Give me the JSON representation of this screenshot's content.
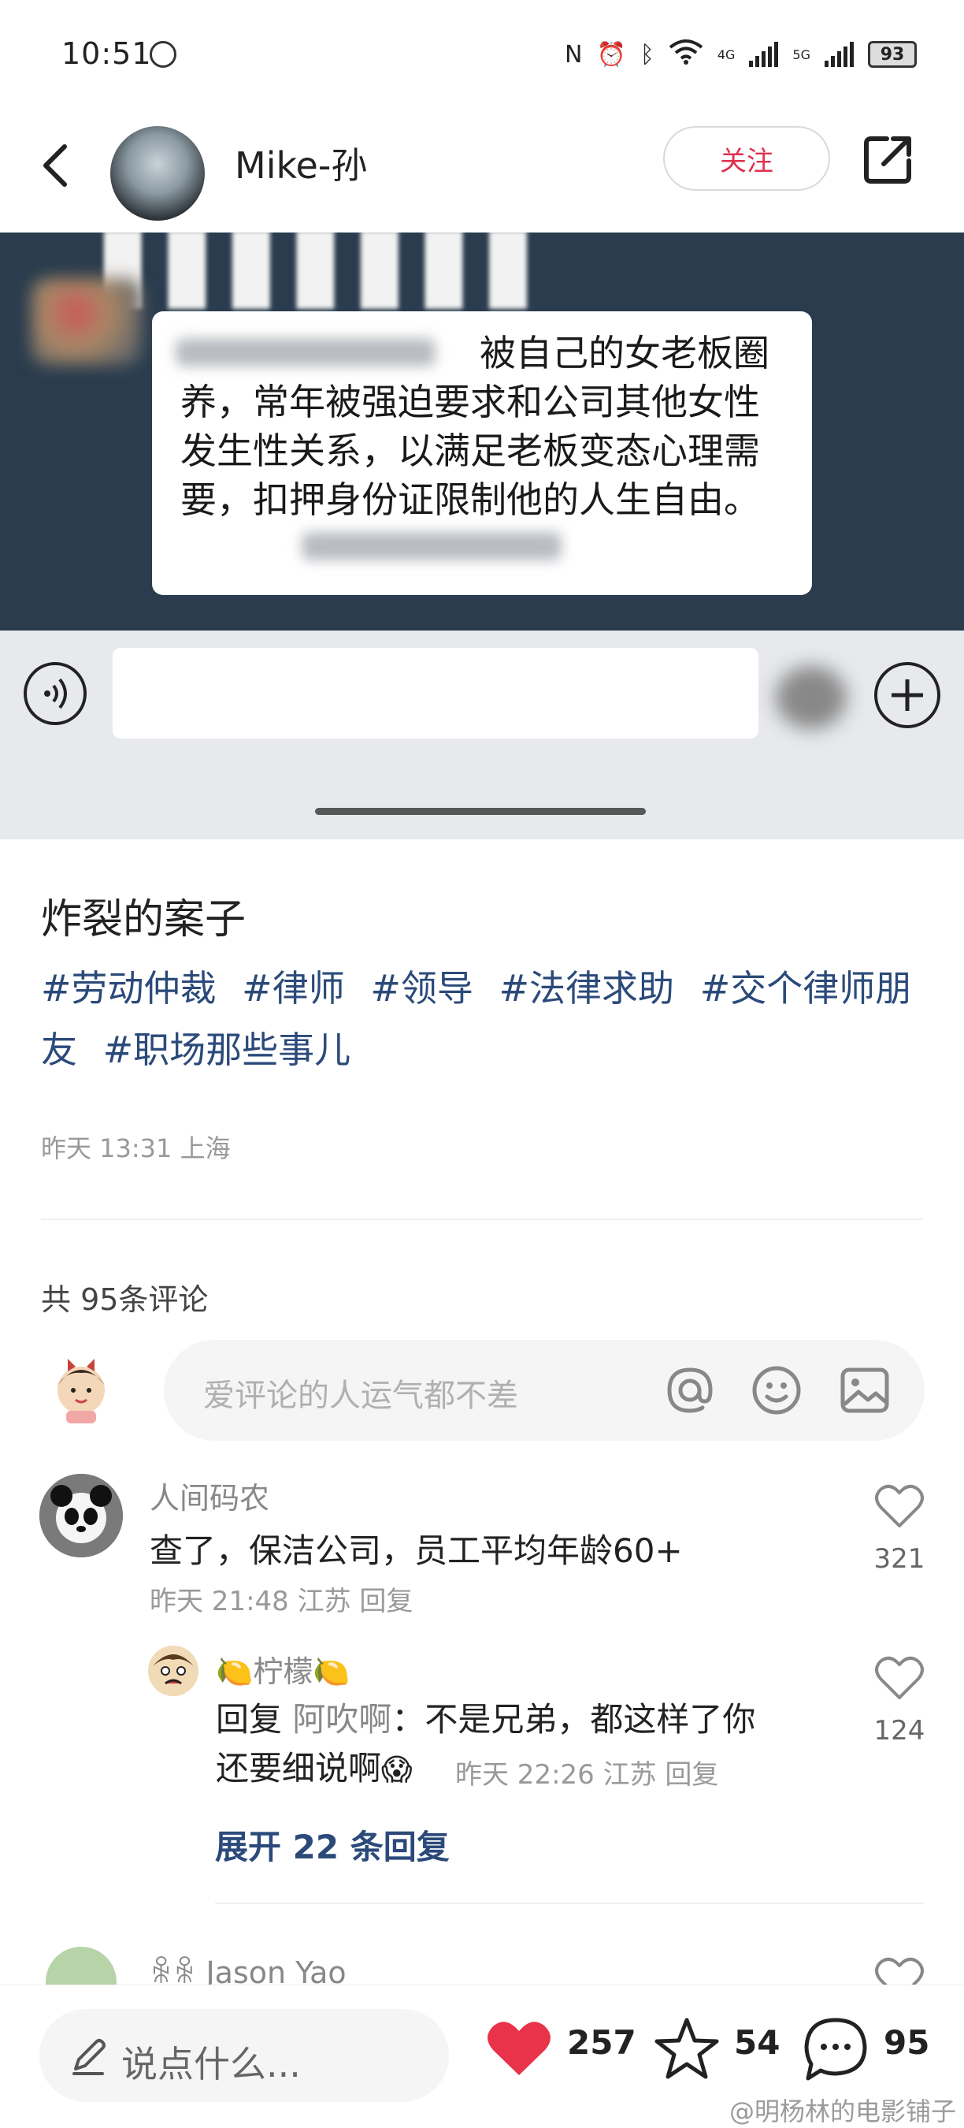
{
  "status_bar": {
    "time": "10:51",
    "network_labels": [
      "4G",
      "5G"
    ],
    "battery": "93"
  },
  "header": {
    "username": "Mike-孙",
    "follow_label": "关注"
  },
  "post_image": {
    "bubble_text": "被自己的女老板圈养，常年被强迫要求和公司其他女性发生性关系，以满足老板变态心理需要，扣押身份证限制他的人生自由。"
  },
  "post": {
    "title": "炸裂的案子",
    "tags": [
      "#劳动仲裁",
      "#律师",
      "#领导",
      "#法律求助",
      "#交个律师朋友",
      "#职场那些事儿"
    ],
    "meta": "昨天 13:31 上海"
  },
  "comments_section": {
    "count_label": "共 95条评论",
    "input_placeholder": "爱评论的人运气都不差"
  },
  "comments": [
    {
      "author": "人间码农",
      "text": "查了，保洁公司，员工平均年龄60+",
      "meta": "昨天 21:48 江苏 回复",
      "likes": "321"
    },
    {
      "author": "🍋柠檬🍋",
      "text_prefix": "回复 ",
      "reply_to": "阿吹啊",
      "text": "：不是兄弟，都这样了你",
      "text_line2": "还要细说啊",
      "emoji": "😱",
      "meta": "昨天 22:26 江苏 回复",
      "likes": "124"
    },
    {
      "author": "ꆜꆜ Jason Yao"
    }
  ],
  "expand_label": "展开 22 条回复",
  "bottom_bar": {
    "input_label": "说点什么...",
    "likes": "257",
    "stars": "54",
    "comments": "95"
  },
  "watermark": "@明杨林的电影铺子",
  "colors": {
    "accent_red": "#e0304f",
    "tag_blue": "#2b4a7a",
    "heart_red": "#e8334a"
  }
}
